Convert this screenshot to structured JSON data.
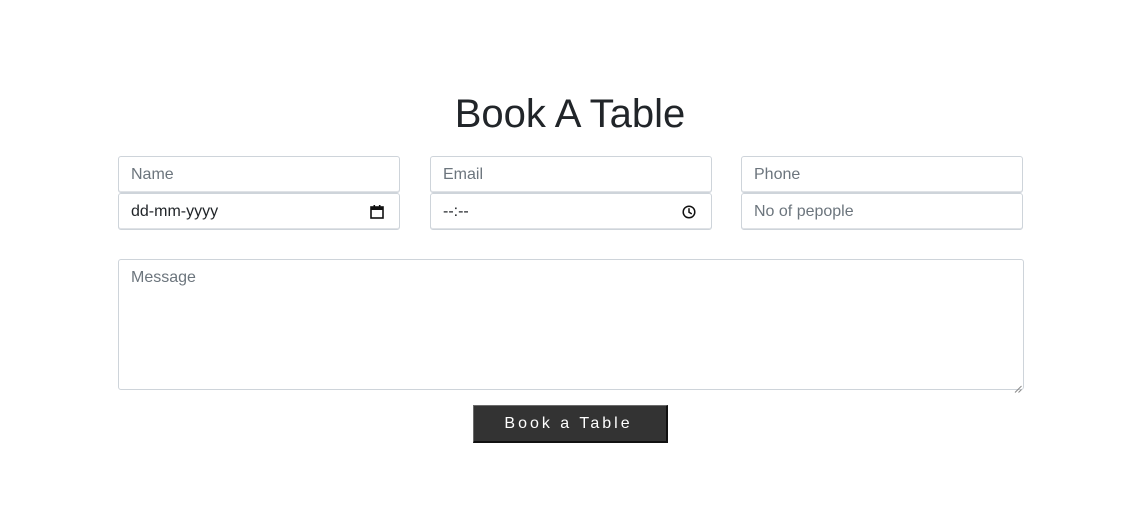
{
  "form": {
    "title": "Book A Table",
    "fields": {
      "name_placeholder": "Name",
      "email_placeholder": "Email",
      "phone_placeholder": "Phone",
      "date_value": "dd-mm-yyyy",
      "time_value": "--:--",
      "people_placeholder": "No of pepople",
      "message_placeholder": "Message"
    },
    "submit_label": "Book a Table"
  },
  "icons": {
    "date": "calendar-icon",
    "time": "clock-icon"
  },
  "colors": {
    "button_bg": "#333333",
    "button_text": "#ffffff",
    "placeholder": "#6c757d",
    "border": "#ced4da",
    "title": "#212529"
  }
}
